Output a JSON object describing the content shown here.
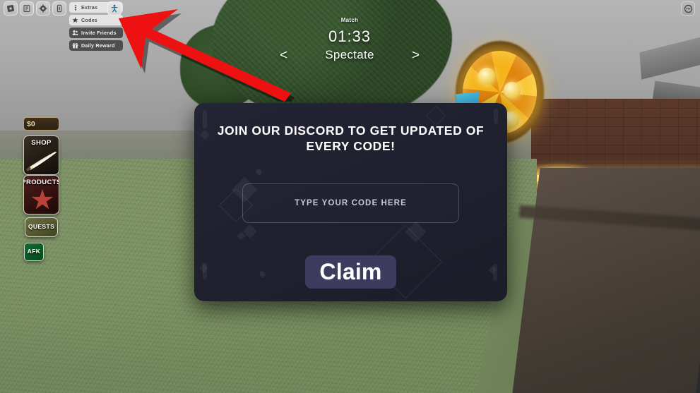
{
  "topbar": {
    "icons": [
      {
        "name": "roblox-logo-icon",
        "glyph": "roblox"
      },
      {
        "name": "chat-list-icon",
        "glyph": "chat-list"
      },
      {
        "name": "settings-gear-icon",
        "glyph": "gear"
      },
      {
        "name": "mobile-capture-icon",
        "glyph": "capture"
      }
    ],
    "right_icon": {
      "name": "chat-bubble-icon",
      "glyph": "chat"
    }
  },
  "extras_menu": {
    "extras_label": "Extras",
    "codes_label": "Codes",
    "invite_friends_label": "Invite Friends",
    "daily_reward_label": "Daily Reward",
    "avatar_button_name": "character-avatar-button"
  },
  "match_hud": {
    "label": "Match",
    "time": "01:33",
    "spectate_label": "Spectate",
    "prev_arrow": "<",
    "next_arrow": ">"
  },
  "side_hud": {
    "cash": "$0",
    "shop_label": "SHOP",
    "products_label": "PRODUCTS",
    "quests_label": "QUESTS",
    "afk_label": "AFK"
  },
  "codes_dialog": {
    "title": "JOIN OUR DISCORD TO GET UPDATED OF EVERY CODE!",
    "input_placeholder": "TYPE YOUR CODE HERE",
    "input_value": "",
    "claim_label": "Claim"
  },
  "annotation": {
    "arrow_color": "#ee1111",
    "arrow_points_to": "Codes"
  },
  "colors": {
    "dialog_bg": "#202130",
    "claim_button": "#3d3b5e",
    "accent_red": "#ee1111",
    "grass": "#7e9167",
    "wheel_gold": "#f6b41b",
    "cash_gold": "#f5e2a8"
  }
}
